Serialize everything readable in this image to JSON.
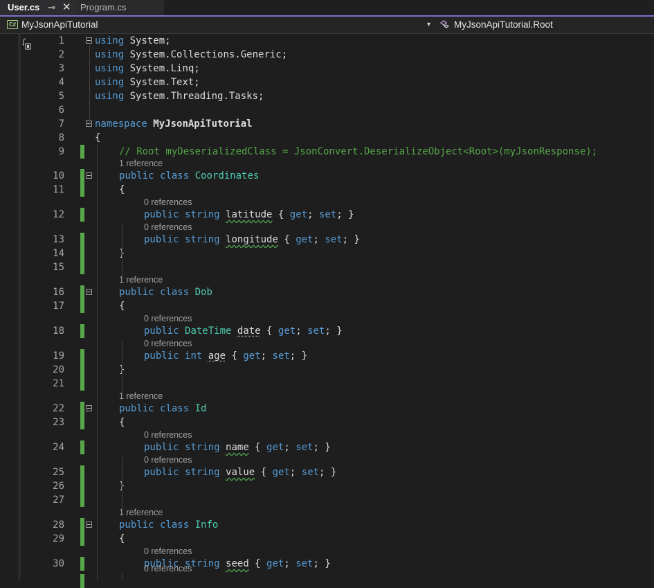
{
  "tabs": {
    "active": {
      "label": "User.cs",
      "pin_glyph": "⊸",
      "close_glyph": "✕"
    },
    "inactive": {
      "label": "Program.cs"
    }
  },
  "navbar": {
    "project_icon_text": "C#",
    "project": "MyJsonApiTutorial",
    "dropdown_glyph": "▾",
    "member": "MyJsonApiTutorial.Root"
  },
  "colors": {
    "keyword": "#569cd6",
    "type": "#4ec9b0",
    "comment": "#57a64a",
    "change_bar": "#57a64a",
    "tab_accent": "#7c6fcf"
  },
  "icons": [
    "cs-project-icon",
    "class-member-icon",
    "collapse-icon",
    "pin-icon",
    "close-icon",
    "margin-icon"
  ],
  "lines": [
    {
      "num": "1",
      "tokens": [
        [
          "kw",
          "using"
        ],
        [
          "nm",
          " System;"
        ]
      ]
    },
    {
      "num": "2",
      "tokens": [
        [
          "kw",
          "using"
        ],
        [
          "nm",
          " System.Collections.Generic;"
        ]
      ]
    },
    {
      "num": "3",
      "tokens": [
        [
          "kw",
          "using"
        ],
        [
          "nm",
          " System.Linq;"
        ]
      ]
    },
    {
      "num": "4",
      "tokens": [
        [
          "kw",
          "using"
        ],
        [
          "nm",
          " System.Text;"
        ]
      ]
    },
    {
      "num": "5",
      "tokens": [
        [
          "kw",
          "using"
        ],
        [
          "nm",
          " System.Threading.Tasks;"
        ]
      ]
    },
    {
      "num": "6",
      "tokens": []
    },
    {
      "num": "7",
      "tokens": [
        [
          "kw",
          "namespace"
        ],
        [
          "nm",
          " "
        ],
        [
          "bold",
          "MyJsonApiTutorial"
        ]
      ]
    },
    {
      "num": "8",
      "tokens": [
        [
          "nm",
          "{"
        ]
      ]
    },
    {
      "num": "9",
      "tokens": [
        [
          "cmt",
          "// Root myDeserializedClass = JsonConvert.DeserializeObject<Root>(myJsonResponse);"
        ]
      ]
    },
    {
      "num": "10",
      "tokens": [
        [
          "kw",
          "public"
        ],
        [
          "nm",
          " "
        ],
        [
          "kw",
          "class"
        ],
        [
          "nm",
          " "
        ],
        [
          "cls",
          "Coordinates"
        ]
      ],
      "lens": "1 reference"
    },
    {
      "num": "11",
      "tokens": [
        [
          "nm",
          "{"
        ]
      ]
    },
    {
      "num": "12",
      "tokens": [
        [
          "kw",
          "public"
        ],
        [
          "nm",
          " "
        ],
        [
          "kw",
          "string"
        ],
        [
          "nm",
          " "
        ],
        [
          "sq",
          "latitude"
        ],
        [
          "nm",
          " { "
        ],
        [
          "kw",
          "get"
        ],
        [
          "nm",
          "; "
        ],
        [
          "kw",
          "set"
        ],
        [
          "nm",
          "; }"
        ]
      ],
      "lens": "0 references"
    },
    {
      "num": "13",
      "tokens": [
        [
          "kw",
          "public"
        ],
        [
          "nm",
          " "
        ],
        [
          "kw",
          "string"
        ],
        [
          "nm",
          " "
        ],
        [
          "sq",
          "longitude"
        ],
        [
          "nm",
          " { "
        ],
        [
          "kw",
          "get"
        ],
        [
          "nm",
          "; "
        ],
        [
          "kw",
          "set"
        ],
        [
          "nm",
          "; }"
        ]
      ],
      "lens": "0 references"
    },
    {
      "num": "14",
      "tokens": [
        [
          "nm",
          "}"
        ]
      ]
    },
    {
      "num": "15",
      "tokens": []
    },
    {
      "num": "16",
      "tokens": [
        [
          "kw",
          "public"
        ],
        [
          "nm",
          " "
        ],
        [
          "kw",
          "class"
        ],
        [
          "nm",
          " "
        ],
        [
          "cls",
          "Dob"
        ]
      ],
      "lens": "1 reference"
    },
    {
      "num": "17",
      "tokens": [
        [
          "nm",
          "{"
        ]
      ]
    },
    {
      "num": "18",
      "tokens": [
        [
          "kw",
          "public"
        ],
        [
          "nm",
          " "
        ],
        [
          "cls",
          "DateTime"
        ],
        [
          "nm",
          " "
        ],
        [
          "dt",
          "date"
        ],
        [
          "nm",
          " { "
        ],
        [
          "kw",
          "get"
        ],
        [
          "nm",
          "; "
        ],
        [
          "kw",
          "set"
        ],
        [
          "nm",
          "; }"
        ]
      ],
      "lens": "0 references"
    },
    {
      "num": "19",
      "tokens": [
        [
          "kw",
          "public"
        ],
        [
          "nm",
          " "
        ],
        [
          "kw",
          "int"
        ],
        [
          "nm",
          " "
        ],
        [
          "dt",
          "age"
        ],
        [
          "nm",
          " { "
        ],
        [
          "kw",
          "get"
        ],
        [
          "nm",
          "; "
        ],
        [
          "kw",
          "set"
        ],
        [
          "nm",
          "; }"
        ]
      ],
      "lens": "0 references"
    },
    {
      "num": "20",
      "tokens": [
        [
          "nm",
          "}"
        ]
      ]
    },
    {
      "num": "21",
      "tokens": []
    },
    {
      "num": "22",
      "tokens": [
        [
          "kw",
          "public"
        ],
        [
          "nm",
          " "
        ],
        [
          "kw",
          "class"
        ],
        [
          "nm",
          " "
        ],
        [
          "cls",
          "Id"
        ]
      ],
      "lens": "1 reference"
    },
    {
      "num": "23",
      "tokens": [
        [
          "nm",
          "{"
        ]
      ]
    },
    {
      "num": "24",
      "tokens": [
        [
          "kw",
          "public"
        ],
        [
          "nm",
          " "
        ],
        [
          "kw",
          "string"
        ],
        [
          "nm",
          " "
        ],
        [
          "sq",
          "name"
        ],
        [
          "nm",
          " { "
        ],
        [
          "kw",
          "get"
        ],
        [
          "nm",
          "; "
        ],
        [
          "kw",
          "set"
        ],
        [
          "nm",
          "; }"
        ]
      ],
      "lens": "0 references"
    },
    {
      "num": "25",
      "tokens": [
        [
          "kw",
          "public"
        ],
        [
          "nm",
          " "
        ],
        [
          "kw",
          "string"
        ],
        [
          "nm",
          " "
        ],
        [
          "sq",
          "value"
        ],
        [
          "nm",
          " { "
        ],
        [
          "kw",
          "get"
        ],
        [
          "nm",
          "; "
        ],
        [
          "kw",
          "set"
        ],
        [
          "nm",
          "; }"
        ]
      ],
      "lens": "0 references"
    },
    {
      "num": "26",
      "tokens": [
        [
          "nm",
          "}"
        ]
      ]
    },
    {
      "num": "27",
      "tokens": []
    },
    {
      "num": "28",
      "tokens": [
        [
          "kw",
          "public"
        ],
        [
          "nm",
          " "
        ],
        [
          "kw",
          "class"
        ],
        [
          "nm",
          " "
        ],
        [
          "cls",
          "Info"
        ]
      ],
      "lens": "1 reference"
    },
    {
      "num": "29",
      "tokens": [
        [
          "nm",
          "{"
        ]
      ]
    },
    {
      "num": "30",
      "tokens": [
        [
          "kw",
          "public"
        ],
        [
          "nm",
          " "
        ],
        [
          "kw",
          "string"
        ],
        [
          "nm",
          " "
        ],
        [
          "sq",
          "seed"
        ],
        [
          "nm",
          " { "
        ],
        [
          "kw",
          "get"
        ],
        [
          "nm",
          "; "
        ],
        [
          "kw",
          "set"
        ],
        [
          "nm",
          "; }"
        ]
      ],
      "lens": "0 references"
    },
    {
      "num": "",
      "tokens": [],
      "lens": "0 references"
    }
  ]
}
